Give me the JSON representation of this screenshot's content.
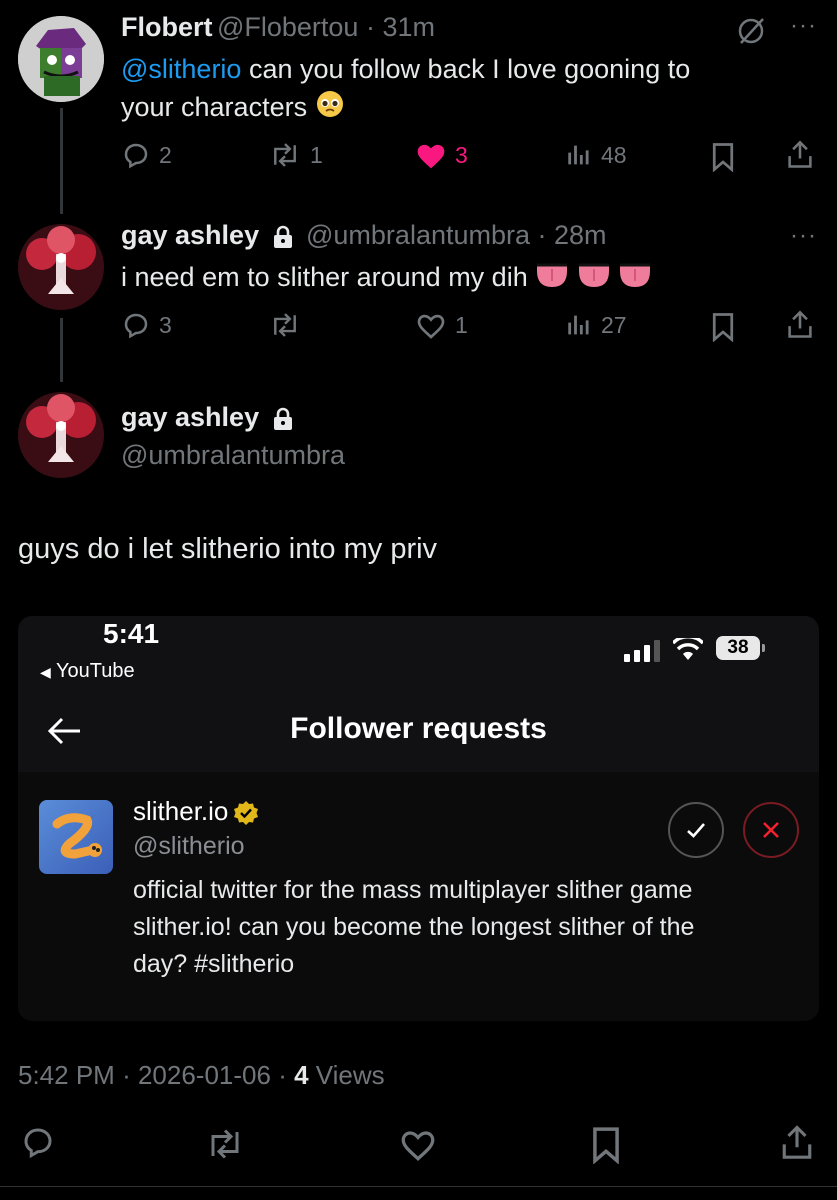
{
  "reply1": {
    "name": "Flobert",
    "handle": "@Flobertou",
    "time": "31m",
    "mention": "@slitherio",
    "text_line1": " can you follow back I love gooning to",
    "text_line2": "your characters",
    "replies": "2",
    "reposts": "1",
    "likes": "3",
    "views": "48"
  },
  "reply2": {
    "name": "gay ashley",
    "handle": "@umbralantumbra",
    "time": "28m",
    "text": "i need em to slither around my dih",
    "replies": "3",
    "reposts": "",
    "likes": "1",
    "views": "27"
  },
  "main_post": {
    "name": "gay ashley",
    "handle": "@umbralantumbra",
    "text": "guys do i let slitherio into my priv",
    "time": "5:42 PM",
    "date": "2026-01-06",
    "views_count": "4",
    "views_label": "Views"
  },
  "screenshot": {
    "clock": "5:41",
    "back_app": "YouTube",
    "battery": "38",
    "title": "Follower requests",
    "account_name": "slither.io",
    "account_handle": "@slitherio",
    "bio_line1": "official twitter for the mass multiplayer slither game",
    "bio_line2": "slither.io! can you become the longest slither of the",
    "bio_line3": "day? #slitherio"
  },
  "colors": {
    "background": "#000000",
    "mention_blue": "#1d9bf0",
    "like_pink": "#f91880",
    "muted": "#71767b",
    "verified_gold": "#e2b719",
    "reject_red": "#f4212e"
  }
}
